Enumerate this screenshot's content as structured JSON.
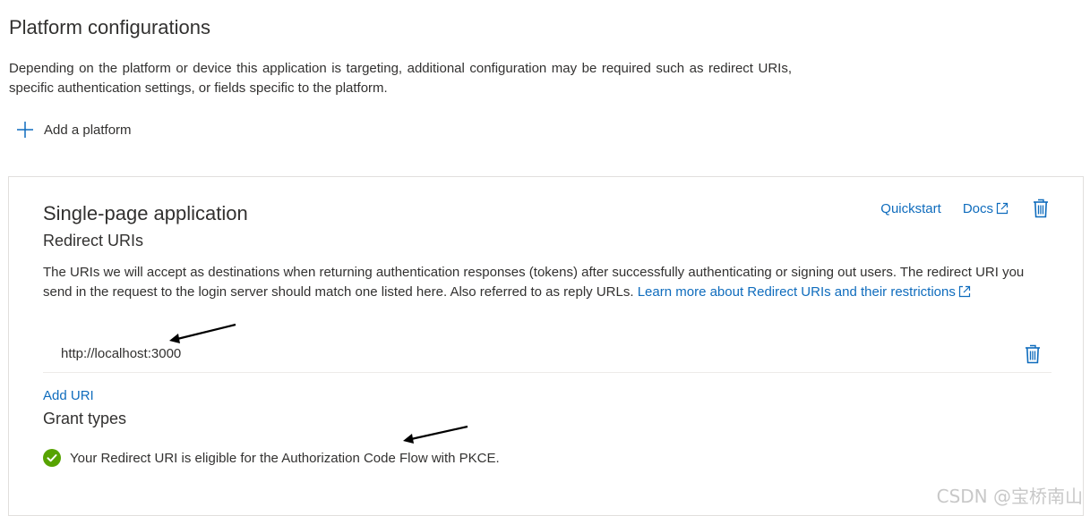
{
  "page": {
    "title": "Platform configurations",
    "description": "Depending on the platform or device this application is targeting, additional configuration may be required such as redirect URIs, specific authentication settings, or fields specific to the platform.",
    "add_platform_label": "Add a platform"
  },
  "spa_card": {
    "title": "Single-page application",
    "quickstart_label": "Quickstart",
    "docs_label": "Docs",
    "redirect_section_title": "Redirect URIs",
    "redirect_description": "The URIs we will accept as destinations when returning authentication responses (tokens) after successfully authenticating or signing out users. The redirect URI you send in the request to the login server should match one listed here. Also referred to as reply URLs. ",
    "learn_more_label": "Learn more about Redirect URIs and their restrictions",
    "uris": [
      "http://localhost:3000"
    ],
    "add_uri_label": "Add URI",
    "grant_section_title": "Grant types",
    "grant_message": "Your Redirect URI is eligible for the Authorization Code Flow with PKCE."
  },
  "watermark": "CSDN @宝桥南山",
  "icons": {
    "add": "plus-icon",
    "external": "external-link-icon",
    "delete": "trash-icon",
    "success": "check-circle-icon",
    "annotation": "arrow-annotation"
  },
  "colors": {
    "link": "#0f6cbd",
    "success": "#57a300",
    "text": "#323130",
    "border": "#e1dfdd"
  }
}
